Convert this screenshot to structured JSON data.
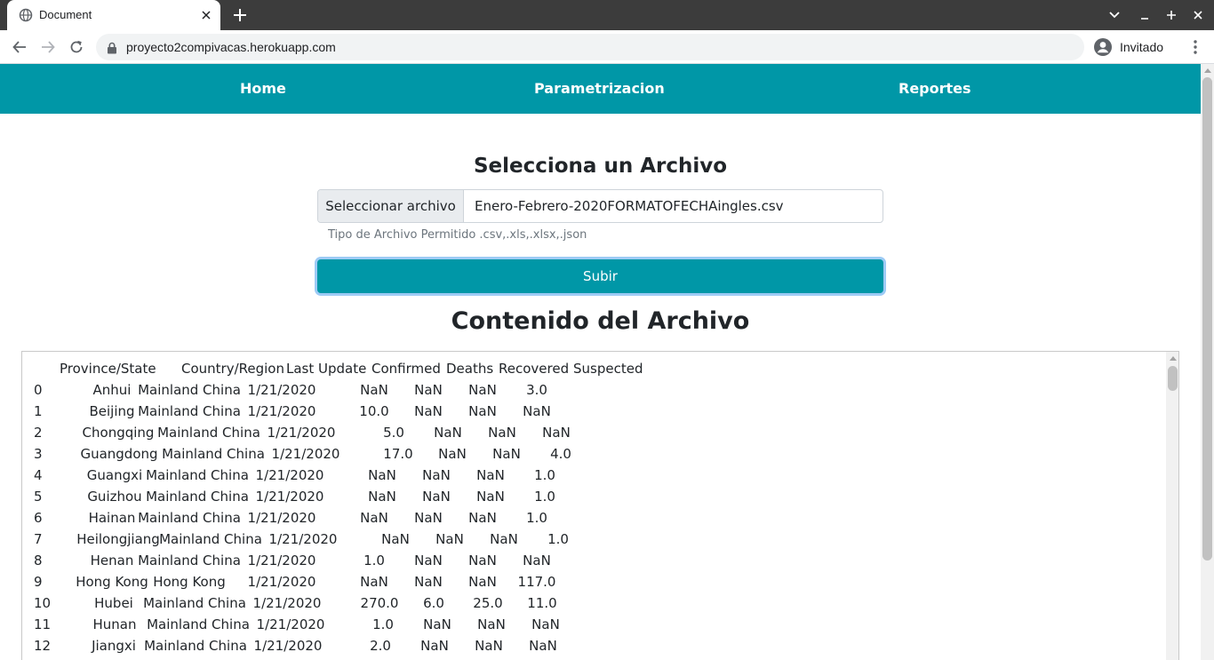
{
  "browser": {
    "tab_title": "Document",
    "url": "proyecto2compivacas.herokuapp.com",
    "profile_label": "Invitado"
  },
  "nav": {
    "home": "Home",
    "parametrizacion": "Parametrizacion",
    "reportes": "Reportes"
  },
  "upload": {
    "heading": "Selecciona un Archivo",
    "choose_button": "Seleccionar archivo",
    "file_name": "Enero-Febrero-2020FORMATOFECHAingles.csv",
    "help": "Tipo de Archivo Permitido .csv,.xls,.xlsx,.json",
    "submit": "Subir"
  },
  "content": {
    "heading": "Contenido del Archivo",
    "columns": [
      "Province/State",
      "Country/Region",
      "Last Update",
      "Confirmed",
      "Deaths",
      "Recovered",
      "Suspected"
    ],
    "rows": [
      [
        "0",
        "Anhui",
        "Mainland China",
        "1/21/2020",
        "NaN",
        "NaN",
        "NaN",
        "3.0"
      ],
      [
        "1",
        "Beijing",
        "Mainland China",
        "1/21/2020",
        "10.0",
        "NaN",
        "NaN",
        "NaN"
      ],
      [
        "2",
        "Chongqing",
        "Mainland China",
        "1/21/2020",
        "5.0",
        "NaN",
        "NaN",
        "NaN"
      ],
      [
        "3",
        "Guangdong",
        "Mainland China",
        "1/21/2020",
        "17.0",
        "NaN",
        "NaN",
        "4.0"
      ],
      [
        "4",
        "Guangxi",
        "Mainland China",
        "1/21/2020",
        "NaN",
        "NaN",
        "NaN",
        "1.0"
      ],
      [
        "5",
        "Guizhou",
        "Mainland China",
        "1/21/2020",
        "NaN",
        "NaN",
        "NaN",
        "1.0"
      ],
      [
        "6",
        "Hainan",
        "Mainland China",
        "1/21/2020",
        "NaN",
        "NaN",
        "NaN",
        "1.0"
      ],
      [
        "7",
        "Heilongjiang",
        "Mainland China",
        "1/21/2020",
        "NaN",
        "NaN",
        "NaN",
        "1.0"
      ],
      [
        "8",
        "Henan",
        "Mainland China",
        "1/21/2020",
        "1.0",
        "NaN",
        "NaN",
        "NaN"
      ],
      [
        "9",
        "Hong Kong",
        "Hong Kong",
        "1/21/2020",
        "NaN",
        "NaN",
        "NaN",
        "117.0"
      ],
      [
        "10",
        "Hubei",
        "Mainland China",
        "1/21/2020",
        "270.0",
        "6.0",
        "25.0",
        "11.0"
      ],
      [
        "11",
        "Hunan",
        "Mainland China",
        "1/21/2020",
        "1.0",
        "NaN",
        "NaN",
        "NaN"
      ],
      [
        "12",
        "Jiangxi",
        "Mainland China",
        "1/21/2020",
        "2.0",
        "NaN",
        "NaN",
        "NaN"
      ]
    ]
  }
}
